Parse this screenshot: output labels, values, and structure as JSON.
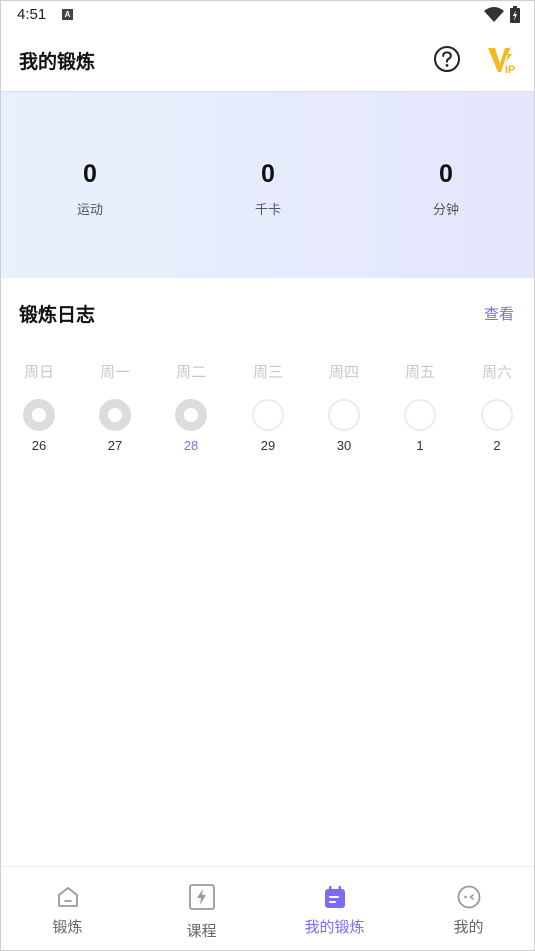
{
  "status_bar": {
    "time": "4:51",
    "notification_icon": "A"
  },
  "header": {
    "title": "我的锻炼",
    "help_icon": "question-circle-icon",
    "vip_icon": "vip-badge-icon"
  },
  "summary": [
    {
      "value": "0",
      "label": "运动"
    },
    {
      "value": "0",
      "label": "千卡"
    },
    {
      "value": "0",
      "label": "分钟"
    }
  ],
  "log": {
    "title": "锻炼日志",
    "view_label": "查看",
    "days": [
      {
        "name": "周日",
        "date": "26",
        "state": "done"
      },
      {
        "name": "周一",
        "date": "27",
        "state": "done"
      },
      {
        "name": "周二",
        "date": "28",
        "state": "done",
        "today": true
      },
      {
        "name": "周三",
        "date": "29",
        "state": "empty"
      },
      {
        "name": "周四",
        "date": "30",
        "state": "empty"
      },
      {
        "name": "周五",
        "date": "1",
        "state": "empty"
      },
      {
        "name": "周六",
        "date": "2",
        "state": "empty"
      }
    ]
  },
  "nav": [
    {
      "label": "锻炼",
      "icon": "home-icon",
      "active": false
    },
    {
      "label": "课程",
      "icon": "lightning-icon",
      "active": false
    },
    {
      "label": "我的锻炼",
      "icon": "calendar-icon",
      "active": true
    },
    {
      "label": "我的",
      "icon": "profile-icon",
      "active": false
    }
  ],
  "colors": {
    "accent": "#7a6df0",
    "vip": "#f5b81e",
    "muted": "#c9c9c9"
  }
}
